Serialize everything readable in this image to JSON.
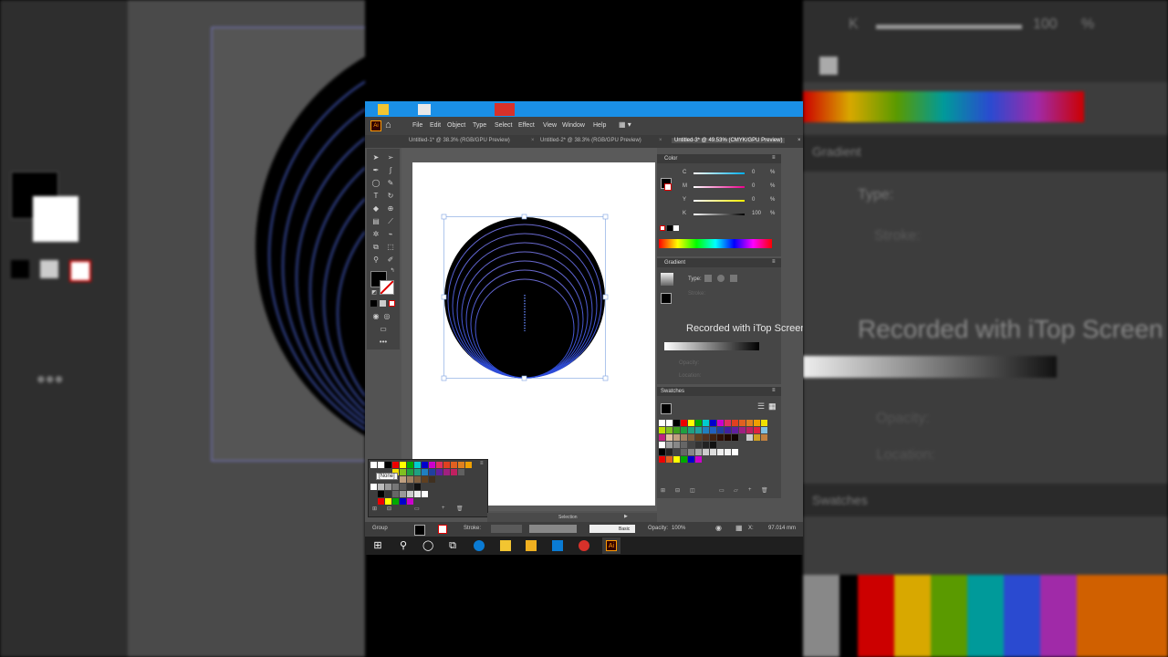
{
  "menu": [
    "File",
    "Edit",
    "Object",
    "Type",
    "Select",
    "Effect",
    "View",
    "Window",
    "Help"
  ],
  "tabs": [
    "Untitled-1* @ 38.3% (RGB/GPU Preview)",
    "Untitled-2* @ 38.3% (RGB/GPU Preview)",
    "Untitled-3* @ 49.53% (CMYK/GPU Preview)"
  ],
  "color_panel": {
    "title": "Color",
    "channels": [
      {
        "label": "C",
        "value": "0"
      },
      {
        "label": "M",
        "value": "0"
      },
      {
        "label": "Y",
        "value": "0"
      },
      {
        "label": "K",
        "value": "100"
      }
    ],
    "unit": "%"
  },
  "gradient_panel": {
    "title": "Gradient",
    "type_label": "Type:",
    "stroke_label": "Stroke:",
    "opacity_label": "Opacity:",
    "location_label": "Location:"
  },
  "swatches_panel": {
    "title": "Swatches"
  },
  "watermark": "Recorded with iTop Screen",
  "watermark_right": "Recorded with iTop Screen",
  "popup_label": "[None]",
  "status": {
    "mode": "Selection",
    "group": "Group",
    "stroke": "Stroke:",
    "basic": "Basic",
    "opacity_label": "Opacity:",
    "opacity_value": "100%",
    "coord": "97.014 mm"
  },
  "right_side": {
    "k_label": "K",
    "k_value": "100",
    "k_unit": "%",
    "gradient_title": "Gradient",
    "type_label": "Type:",
    "stroke_label": "Stroke:",
    "opacity_label": "Opacity:",
    "location_label": "Location:",
    "swatches_title": "Swatches"
  },
  "app_icon": "Ai",
  "colors": {
    "artwork_fill": "#000000",
    "artwork_stroke": "#4b68d8",
    "titlebar": "#1a8fe6"
  }
}
